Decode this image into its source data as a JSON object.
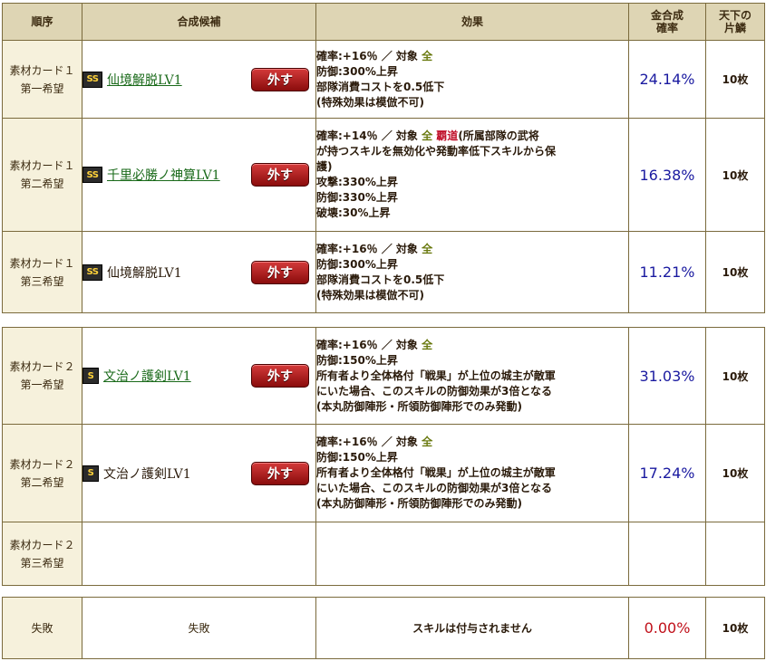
{
  "header": {
    "order": "順序",
    "candidate": "合成候補",
    "effect": "効果",
    "prob_line1": "金合成",
    "prob_line2": "確率",
    "count_line1": "天下の",
    "count_line2": "片鱗"
  },
  "remove_label": "外す",
  "group1": [
    {
      "order1": "素材カード１",
      "order2": "第一希望",
      "rank": "SS",
      "skill": "仙境解脱LV1",
      "linked": true,
      "eff_line1_prefix": "確率:+16％ ／ 対象 ",
      "eff_target": "全",
      "eff_lines": [
        "防御:300%上昇",
        "部隊消費コストを0.5低下",
        "(特殊効果は模倣不可)"
      ],
      "prob": "24.14%",
      "count": "10枚"
    },
    {
      "order1": "素材カード１",
      "order2": "第二希望",
      "rank": "SS",
      "skill": "千里必勝ノ神算LV1",
      "linked": true,
      "eff_line1_prefix": "確率:+14％ ／ 対象 ",
      "eff_target": "全",
      "eff_hado": "覇道",
      "eff_hado_rest": "(所属部隊の武将",
      "eff_lines": [
        "が持つスキルを無効化や発動率低下スキルから保",
        "護)",
        "攻撃:330%上昇",
        "防御:330%上昇",
        "破壊:30%上昇"
      ],
      "prob": "16.38%",
      "count": "10枚"
    },
    {
      "order1": "素材カード１",
      "order2": "第三希望",
      "rank": "SS",
      "skill": "仙境解脱LV1",
      "linked": false,
      "eff_line1_prefix": "確率:+16％ ／ 対象 ",
      "eff_target": "全",
      "eff_lines": [
        "防御:300%上昇",
        "部隊消費コストを0.5低下",
        "(特殊効果は模倣不可)"
      ],
      "prob": "11.21%",
      "count": "10枚"
    }
  ],
  "group2": [
    {
      "order1": "素材カード２",
      "order2": "第一希望",
      "rank": "S",
      "skill": "文治ノ護剣LV1",
      "linked": true,
      "eff_line1_prefix": "確率:+16％ ／ 対象 ",
      "eff_target": "全",
      "eff_lines": [
        "防御:150%上昇",
        "所有者より全体格付「戦果」が上位の城主が敵軍",
        "にいた場合、このスキルの防御効果が3倍となる",
        "(本丸防御陣形・所領防御陣形でのみ発動)"
      ],
      "prob": "31.03%",
      "count": "10枚"
    },
    {
      "order1": "素材カード２",
      "order2": "第二希望",
      "rank": "S",
      "skill": "文治ノ護剣LV1",
      "linked": false,
      "eff_line1_prefix": "確率:+16％ ／ 対象 ",
      "eff_target": "全",
      "eff_lines": [
        "防御:150%上昇",
        "所有者より全体格付「戦果」が上位の城主が敵軍",
        "にいた場合、このスキルの防御効果が3倍となる",
        "(本丸防御陣形・所領防御陣形でのみ発動)"
      ],
      "prob": "17.24%",
      "count": "10枚"
    },
    {
      "order1": "素材カード２",
      "order2": "第三希望"
    }
  ],
  "failure": {
    "order": "失敗",
    "candidate": "失敗",
    "effect": "スキルは付与されません",
    "prob": "0.00%",
    "count": "10枚"
  },
  "colors": {
    "header_bg": "#ded5b4",
    "order_bg": "#f6f1dc",
    "prob_text": "#1a1aa0",
    "fail_prob_text": "#c0101a",
    "target_text": "#6a7a10",
    "hado_text": "#c0102a",
    "link_text": "#1a6a1a",
    "remove_button": "#b01e1e"
  },
  "icons": {
    "remove": "remove-button",
    "rank": "rank-badge"
  }
}
